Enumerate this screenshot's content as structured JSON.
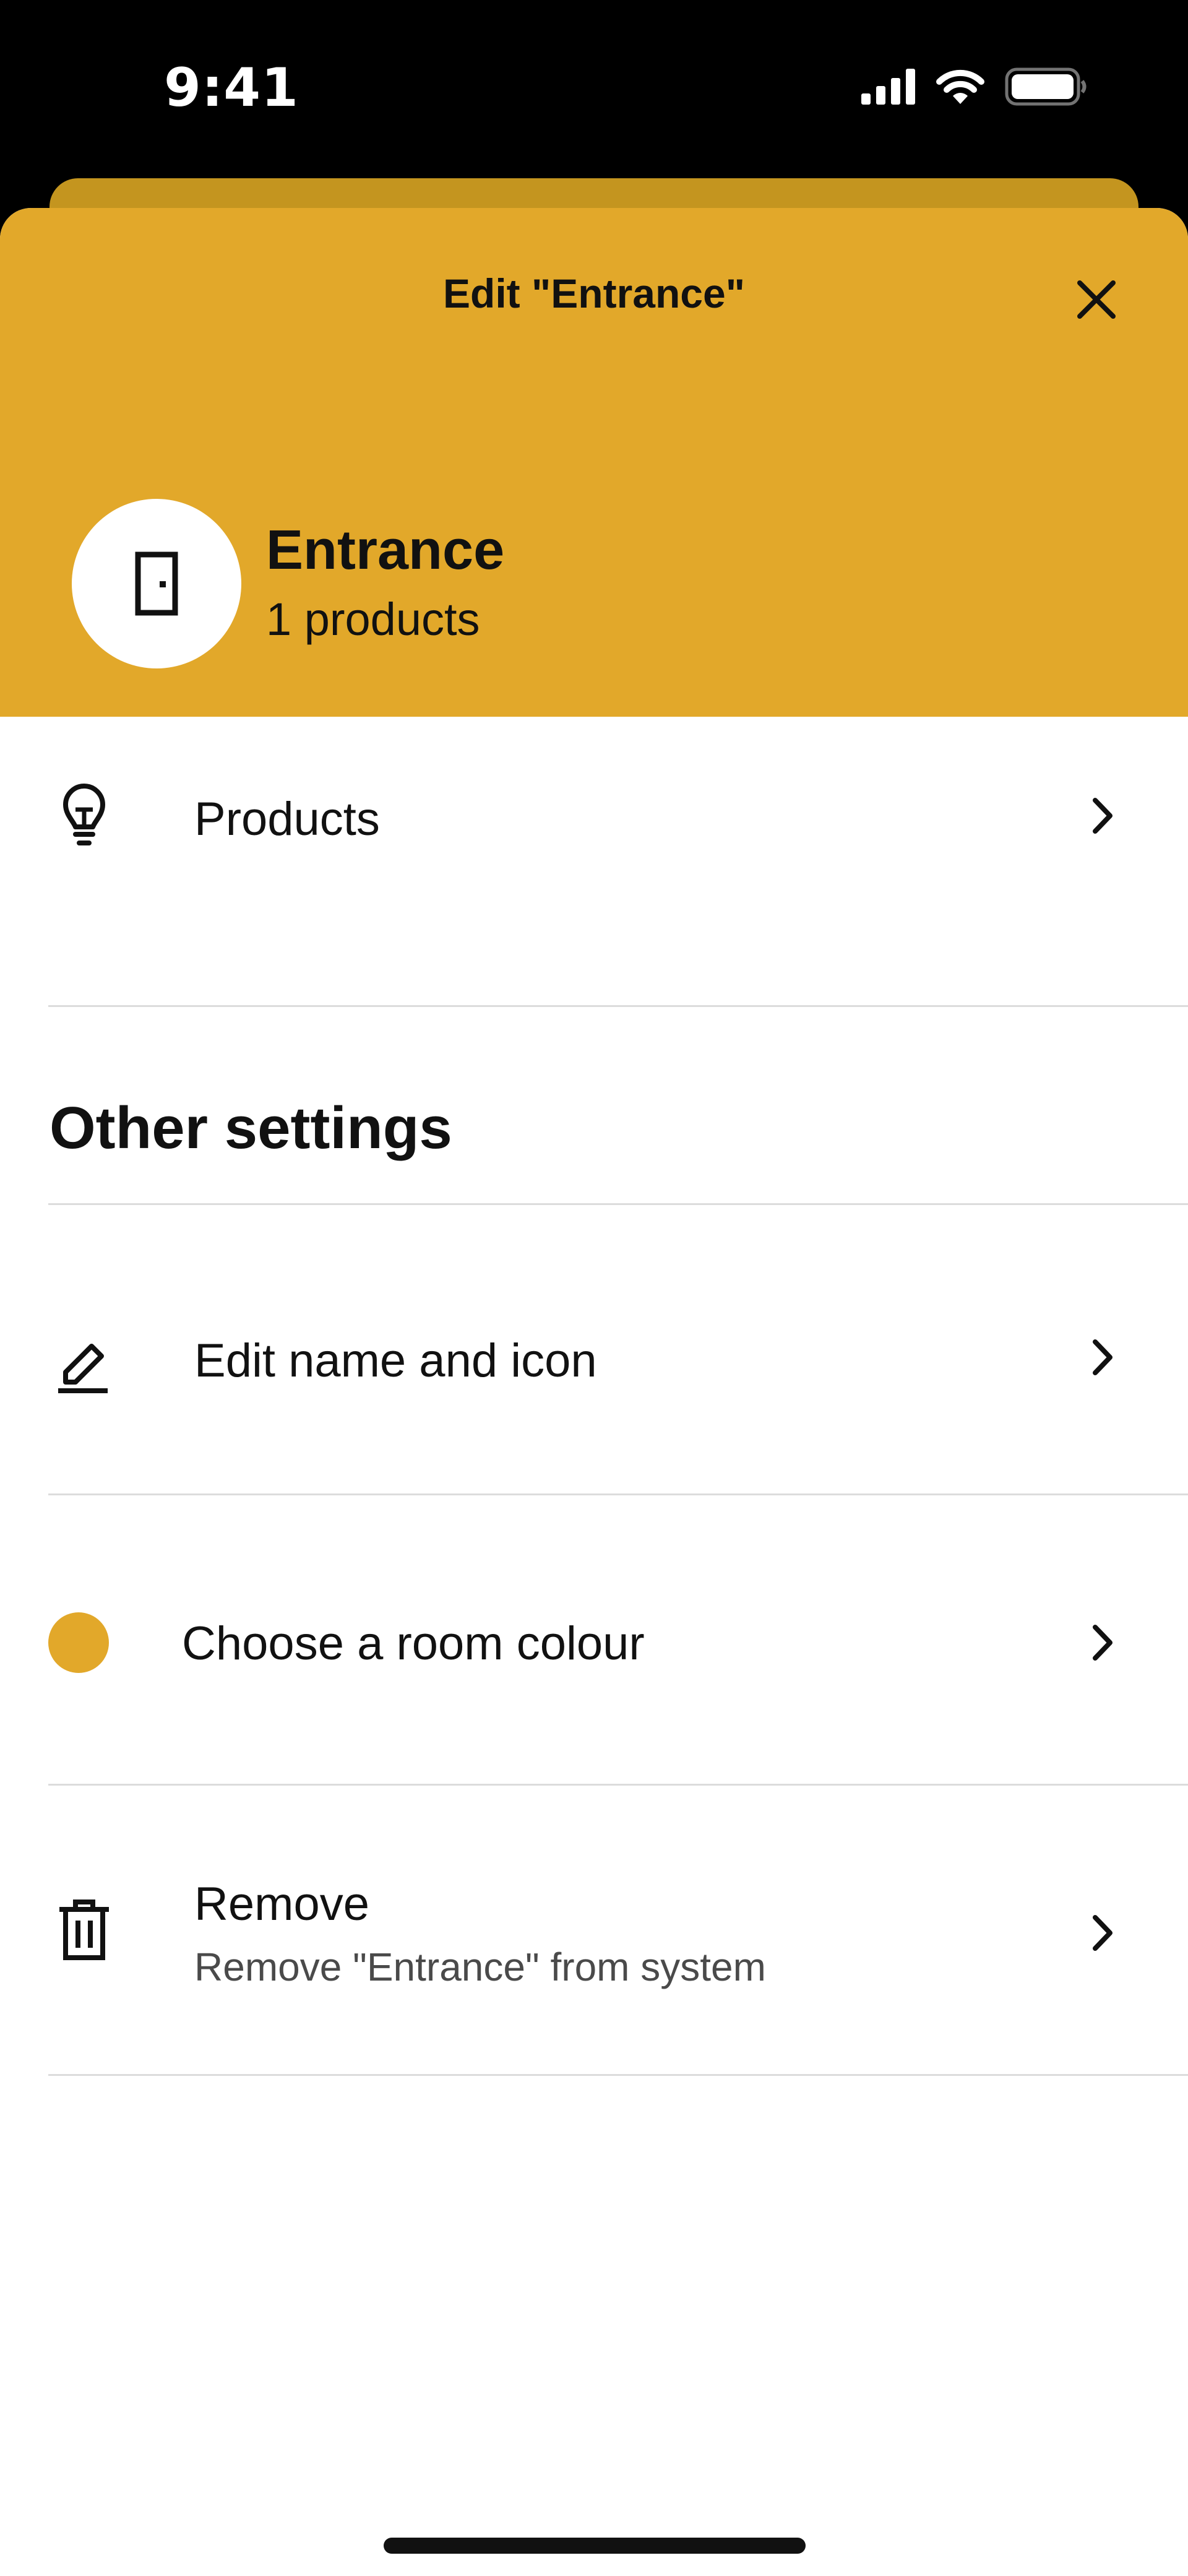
{
  "status_bar": {
    "time": "9:41",
    "icons": [
      "cellular-signal-icon",
      "wifi-icon",
      "battery-icon"
    ]
  },
  "sheet": {
    "title": "Edit \"Entrance\"",
    "close_icon": "close-icon"
  },
  "room": {
    "icon": "door-icon",
    "name": "Entrance",
    "product_count": "1 products",
    "color": "#e2a82a"
  },
  "rows": {
    "products": {
      "icon": "lightbulb-icon",
      "label": "Products"
    },
    "edit_name": {
      "icon": "pencil-icon",
      "label": "Edit name and icon"
    },
    "room_colour": {
      "icon": "color-dot",
      "label": "Choose a room colour"
    },
    "remove": {
      "icon": "trash-icon",
      "label": "Remove",
      "sublabel": "Remove \"Entrance\" from system"
    }
  },
  "sections": {
    "other_settings": "Other settings"
  },
  "colors": {
    "accent": "#e2a82a",
    "accent_dark": "#c4951f",
    "text": "#111111",
    "subtext": "#4a4a4a",
    "divider": "#dcdcdc"
  }
}
